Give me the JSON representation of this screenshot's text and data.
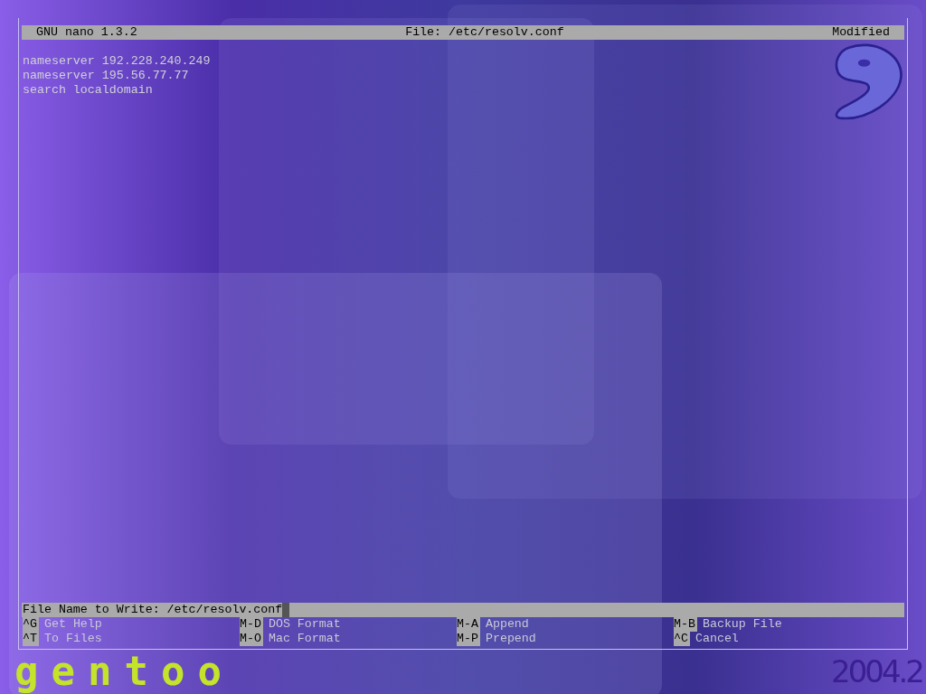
{
  "title_bar": {
    "app": "GNU nano 1.3.2",
    "file": "File: /etc/resolv.conf",
    "status": "Modified"
  },
  "lines": [
    "nameserver 192.228.240.249",
    "nameserver 195.56.77.77",
    "search localdomain"
  ],
  "prompt": {
    "label": "File Name to Write: ",
    "value": "/etc/resolv.conf"
  },
  "shortcuts": [
    {
      "key": "^G",
      "label": "Get Help"
    },
    {
      "key": "M-D",
      "label": "DOS Format"
    },
    {
      "key": "M-A",
      "label": "Append"
    },
    {
      "key": "M-B",
      "label": "Backup File"
    },
    {
      "key": "^T",
      "label": "To Files"
    },
    {
      "key": "M-O",
      "label": "Mac Format"
    },
    {
      "key": "M-P",
      "label": "Prepend"
    },
    {
      "key": "^C",
      "label": "Cancel"
    }
  ],
  "branding": {
    "logo": "gentoo",
    "version": "2004.2"
  }
}
